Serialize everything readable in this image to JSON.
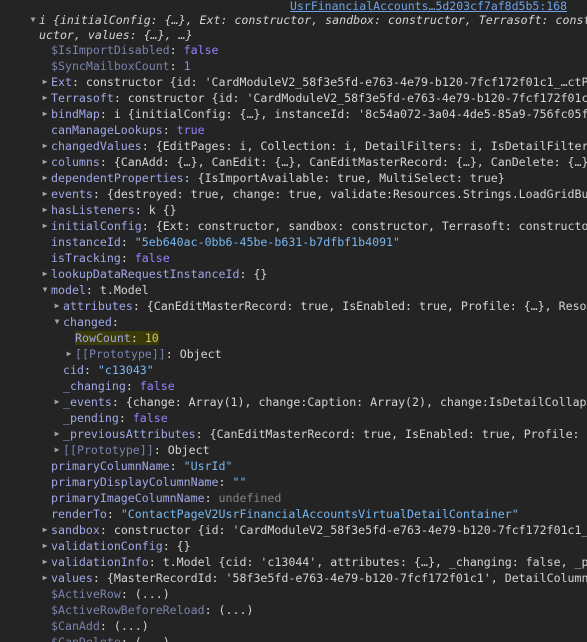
{
  "source_link": "UsrFinancialAccounts…5d203cf7af8d5b5:168",
  "header_line_1": "i {initialConfig: {…}, Ext: constructor, sandbox: constructor, Terrasoft: constr",
  "header_line_2": "uctor, values: {…}, …}",
  "rows": [
    {
      "indent": 0,
      "arrow": "",
      "key": "$IsImportDisabled",
      "dim": true,
      "value": "false",
      "vclass": "b"
    },
    {
      "indent": 0,
      "arrow": "",
      "key": "$SyncMailboxCount",
      "dim": true,
      "value": "1",
      "vclass": "n"
    },
    {
      "indent": 0,
      "arrow": "▶",
      "key": "Ext",
      "value": "constructor {id: 'CardModuleV2_58f3e5fd-e763-4e79-b120-7fcf172f01c1_…ctPag",
      "vclass": "t"
    },
    {
      "indent": 0,
      "arrow": "▶",
      "key": "Terrasoft",
      "value": "constructor {id: 'CardModuleV2_58f3e5fd-e763-4e79-b120-7fcf172f01c1_…",
      "vclass": "t"
    },
    {
      "indent": 0,
      "arrow": "▶",
      "key": "bindMap",
      "value": "i {initialConfig: {…}, instanceId: '8c54a072-3a04-4de5-85a9-756fc05fc6",
      "vclass": "t"
    },
    {
      "indent": 0,
      "arrow": "",
      "key": "canManageLookups",
      "value": "true",
      "vclass": "b"
    },
    {
      "indent": 0,
      "arrow": "▶",
      "key": "changedValues",
      "value": "{EditPages: i, Collection: i, DetailFilters: i, IsDetailFilterVi",
      "vclass": "t"
    },
    {
      "indent": 0,
      "arrow": "▶",
      "key": "columns",
      "value": "{CanAdd: {…}, CanEdit: {…}, CanEditMasterRecord: {…}, CanDelete: {…},",
      "vclass": "t"
    },
    {
      "indent": 0,
      "arrow": "▶",
      "key": "dependentProperties",
      "value": "{IsImportAvailable: true, MultiSelect: true}",
      "vclass": "t"
    },
    {
      "indent": 0,
      "arrow": "▶",
      "key": "events",
      "value": "{destroyed: true, change: true, validate:Resources.Strings.LoadGridButt",
      "vclass": "t"
    },
    {
      "indent": 0,
      "arrow": "▶",
      "key": "hasListeners",
      "value": "k {}",
      "vclass": "t"
    },
    {
      "indent": 0,
      "arrow": "▶",
      "key": "initialConfig",
      "value": "{Ext: constructor, sandbox: constructor, Terrasoft: constructor,",
      "vclass": "t"
    },
    {
      "indent": 0,
      "arrow": "",
      "key": "instanceId",
      "value": "\"5eb640ac-0bb6-45be-b631-b7dfbf1b4091\"",
      "vclass": "s2"
    },
    {
      "indent": 0,
      "arrow": "",
      "key": "isTracking",
      "value": "false",
      "vclass": "b"
    },
    {
      "indent": 0,
      "arrow": "▶",
      "key": "lookupDataRequestInstanceId",
      "value": "{}",
      "vclass": "t"
    },
    {
      "indent": 0,
      "arrow": "▼",
      "key": "model",
      "value": "t.Model",
      "vclass": "t"
    },
    {
      "indent": 1,
      "arrow": "▶",
      "key": "attributes",
      "value": "{CanEditMasterRecord: true, IsEnabled: true, Profile: {…}, Resour",
      "vclass": "t"
    },
    {
      "indent": 1,
      "arrow": "▼",
      "key": "changed",
      "value": "",
      "vclass": "t"
    },
    {
      "indent": 2,
      "arrow": "",
      "key": "RowCount",
      "value": "10",
      "vclass": "n",
      "highlight": true
    },
    {
      "indent": 2,
      "arrow": "▶",
      "key": "[[Prototype]]",
      "dim": true,
      "value": "Object",
      "vclass": "t"
    },
    {
      "indent": 1,
      "arrow": "",
      "key": "cid",
      "value": "\"c13043\"",
      "vclass": "s2"
    },
    {
      "indent": 1,
      "arrow": "",
      "key": "_changing",
      "value": "false",
      "vclass": "b"
    },
    {
      "indent": 1,
      "arrow": "▶",
      "key": "_events",
      "value": "{change: Array(1), change:Caption: Array(2), change:IsDetailCollapse",
      "vclass": "t"
    },
    {
      "indent": 1,
      "arrow": "",
      "key": "_pending",
      "value": "false",
      "vclass": "b"
    },
    {
      "indent": 1,
      "arrow": "▶",
      "key": "_previousAttributes",
      "value": "{CanEditMasterRecord: true, IsEnabled: true, Profile: {…}",
      "vclass": "t"
    },
    {
      "indent": 1,
      "arrow": "▶",
      "key": "[[Prototype]]",
      "dim": true,
      "value": "Object",
      "vclass": "t"
    },
    {
      "indent": 0,
      "arrow": "",
      "key": "primaryColumnName",
      "value": "\"UsrId\"",
      "vclass": "s2"
    },
    {
      "indent": 0,
      "arrow": "",
      "key": "primaryDisplayColumnName",
      "value": "\"\"",
      "vclass": "s2"
    },
    {
      "indent": 0,
      "arrow": "",
      "key": "primaryImageColumnName",
      "value": "undefined",
      "vclass": "u"
    },
    {
      "indent": 0,
      "arrow": "",
      "key": "renderTo",
      "value": "\"ContactPageV2UsrFinancialAccountsVirtualDetailContainer\"",
      "vclass": "s2"
    },
    {
      "indent": 0,
      "arrow": "▶",
      "key": "sandbox",
      "value": "constructor {id: 'CardModuleV2_58f3e5fd-e763-4e79-b120-7fcf172f01c1_…",
      "vclass": "t"
    },
    {
      "indent": 0,
      "arrow": "▶",
      "key": "validationConfig",
      "value": "{}",
      "vclass": "t"
    },
    {
      "indent": 0,
      "arrow": "▶",
      "key": "validationInfo",
      "value": "t.Model {cid: 'c13044', attributes: {…}, _changing: false, _pre",
      "vclass": "t"
    },
    {
      "indent": 0,
      "arrow": "▶",
      "key": "values",
      "value": "{MasterRecordId: '58f3e5fd-e763-4e79-b120-7fcf172f01c1', DetailColumnNa",
      "vclass": "t"
    },
    {
      "indent": 0,
      "arrow": "",
      "key": "$ActiveRow",
      "dim": true,
      "value": "(...)",
      "vclass": "t"
    },
    {
      "indent": 0,
      "arrow": "",
      "key": "$ActiveRowBeforeReload",
      "dim": true,
      "value": "(...)",
      "vclass": "t"
    },
    {
      "indent": 0,
      "arrow": "",
      "key": "$CanAdd",
      "dim": true,
      "value": "(...)",
      "vclass": "t"
    },
    {
      "indent": 0,
      "arrow": "",
      "key": "$CanDelete",
      "dim": true,
      "value": "(...)",
      "vclass": "t"
    }
  ]
}
